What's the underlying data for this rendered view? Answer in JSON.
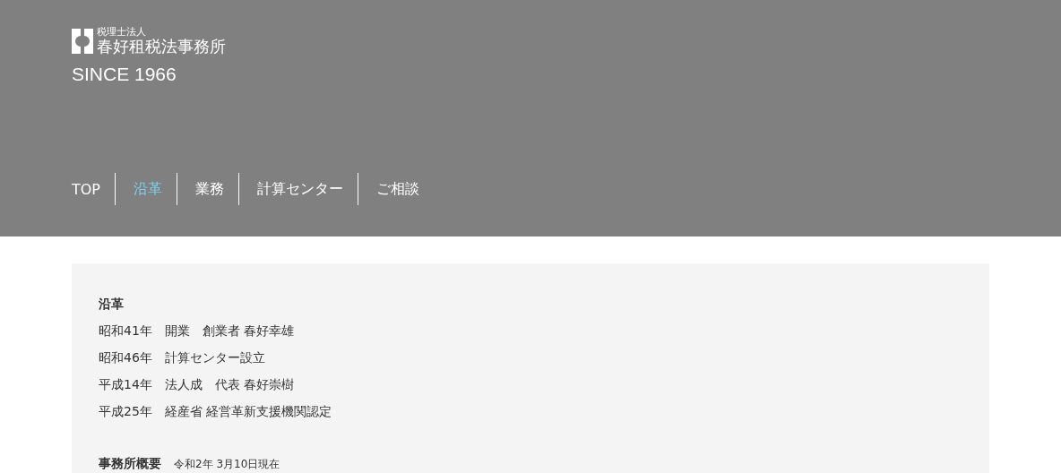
{
  "header": {
    "logo": {
      "subtitle": "税理士法人",
      "name": "春好租税法事務所"
    },
    "since": "SINCE 1966",
    "nav": [
      {
        "label": "TOP",
        "selected": false
      },
      {
        "label": "沿革",
        "selected": true
      },
      {
        "label": "業務",
        "selected": false
      },
      {
        "label": "計算センター",
        "selected": false
      },
      {
        "label": "ご相談",
        "selected": false
      }
    ]
  },
  "history": {
    "heading": "沿革",
    "lines": [
      "昭和41年　開業　創業者 春好幸雄",
      "昭和46年　計算センター設立",
      "平成14年　法人成　代表 春好崇樹",
      "平成25年　経産省 経営革新支援機関認定"
    ]
  },
  "overview": {
    "heading": "事務所概要",
    "note": "令和2年 3月10日現在"
  }
}
